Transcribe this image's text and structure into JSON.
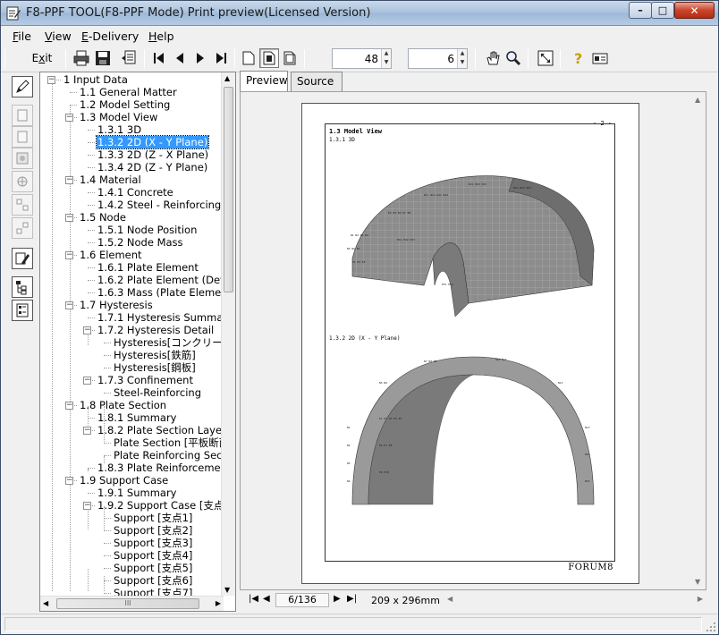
{
  "window": {
    "title": "F8-PPF TOOL(F8-PPF Mode) Print preview(Licensed Version)",
    "controls": {
      "minimize": "–",
      "maximize": "□",
      "close": "✕"
    }
  },
  "menubar": [
    {
      "label": "File",
      "u": "F",
      "rest": "ile"
    },
    {
      "label": "View",
      "u": "V",
      "rest": "iew"
    },
    {
      "label": "E-Delivery",
      "u": "E",
      "rest": "-Delivery"
    },
    {
      "label": "Help",
      "u": "H",
      "rest": "elp"
    }
  ],
  "toolbar": {
    "exit_label": "Exit",
    "exit_u": "x",
    "zoom_value": "48",
    "pages_value": "6"
  },
  "tabs": {
    "preview": "Preview",
    "source": "Source"
  },
  "tree": [
    {
      "label": "1 Input Data",
      "level": 0,
      "box": "−"
    },
    {
      "label": "1.1 General Matter",
      "level": 1
    },
    {
      "label": "1.2 Model Setting",
      "level": 1
    },
    {
      "label": "1.3 Model View",
      "level": 1,
      "box": "−"
    },
    {
      "label": "1.3.1 3D",
      "level": 2
    },
    {
      "label": "1.3.2 2D (X - Y Plane)",
      "level": 2,
      "selected": true
    },
    {
      "label": "1.3.3 2D (Z - X Plane)",
      "level": 2
    },
    {
      "label": "1.3.4 2D (Z - Y Plane)",
      "level": 2
    },
    {
      "label": "1.4 Material",
      "level": 1,
      "box": "−"
    },
    {
      "label": "1.4.1 Concrete",
      "level": 2
    },
    {
      "label": "1.4.2 Steel - Reinforcing",
      "level": 2
    },
    {
      "label": "1.5 Node",
      "level": 1,
      "box": "−"
    },
    {
      "label": "1.5.1 Node Position",
      "level": 2
    },
    {
      "label": "1.5.2 Node Mass",
      "level": 2
    },
    {
      "label": "1.6 Element",
      "level": 1,
      "box": "−"
    },
    {
      "label": "1.6.1 Plate Element",
      "level": 2
    },
    {
      "label": "1.6.2 Plate Element (Detail)",
      "level": 2
    },
    {
      "label": "1.6.3 Mass (Plate Element)",
      "level": 2
    },
    {
      "label": "1.7 Hysteresis",
      "level": 1,
      "box": "−"
    },
    {
      "label": "1.7.1 Hysteresis Summary",
      "level": 2
    },
    {
      "label": "1.7.2 Hysteresis Detail",
      "level": 2,
      "box": "−"
    },
    {
      "label": "Hysteresis[コンクリート]",
      "level": 3
    },
    {
      "label": "Hysteresis[鉄筋]",
      "level": 3
    },
    {
      "label": "Hysteresis[鋼板]",
      "level": 3
    },
    {
      "label": "1.7.3 Confinement",
      "level": 2,
      "box": "−"
    },
    {
      "label": "Steel-Reinforcing",
      "level": 3
    },
    {
      "label": "1.8 Plate Section",
      "level": 1,
      "box": "−"
    },
    {
      "label": "1.8.1 Summary",
      "level": 2
    },
    {
      "label": "1.8.2 Plate Section Layers",
      "level": 2,
      "box": "−"
    },
    {
      "label": "Plate Section [平板断面",
      "level": 3
    },
    {
      "label": "Plate Reinforcing Sectio",
      "level": 3
    },
    {
      "label": "1.8.3 Plate Reinforcement M",
      "level": 2
    },
    {
      "label": "1.9 Support Case",
      "level": 1,
      "box": "−"
    },
    {
      "label": "1.9.1 Summary",
      "level": 2
    },
    {
      "label": "1.9.2 Support Case [支点ケ",
      "level": 2,
      "box": "−"
    },
    {
      "label": "Support [支点1]",
      "level": 3
    },
    {
      "label": "Support [支点2]",
      "level": 3
    },
    {
      "label": "Support [支点3]",
      "level": 3
    },
    {
      "label": "Support [支点4]",
      "level": 3
    },
    {
      "label": "Support [支点5]",
      "level": 3
    },
    {
      "label": "Support [支点6]",
      "level": 3
    },
    {
      "label": "Support [支点7]",
      "level": 3
    }
  ],
  "page": {
    "number": "- 2 -",
    "section_title": "1.3 Model View",
    "sub1": "1.3.1 3D",
    "sub2": "1.3.2 2D (X - Y Plane)",
    "footer_logo": "FORUM8"
  },
  "nav": {
    "page_indicator": "6/136",
    "paper_size": "209 x 296mm",
    "hscroll_thumb": "III"
  },
  "colors": {
    "selection": "#3399ff",
    "model_gray": "#8a8a8a",
    "title_gradient_top": "#c9d9ea"
  }
}
